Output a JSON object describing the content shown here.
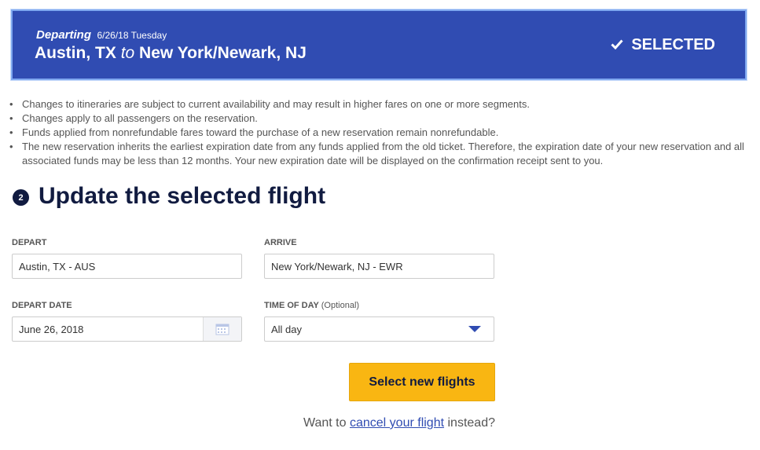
{
  "colors": {
    "banner": "#304cb2",
    "accent_button": "#f9b612",
    "title": "#111b40",
    "link": "#304cb2"
  },
  "banner": {
    "departing_label": "Departing",
    "date": "6/26/18 Tuesday",
    "origin": "Austin, TX",
    "to_word": "to",
    "destination": "New York/Newark, NJ",
    "status_icon": "check-icon",
    "status": "SELECTED"
  },
  "notes": [
    "Changes to itineraries are subject to current availability and may result in higher fares on one or more segments.",
    "Changes apply to all passengers on the reservation.",
    "Funds applied from nonrefundable fares toward the purchase of a new reservation remain nonrefundable.",
    "The new reservation inherits the earliest expiration date from any funds applied from the old ticket. Therefore, the expiration date of your new reservation and all associated funds may be less than 12 months. Your new expiration date will be displayed on the confirmation receipt sent to you."
  ],
  "section": {
    "step": "2",
    "title": "Update the selected flight"
  },
  "form": {
    "depart": {
      "label": "DEPART",
      "value": "Austin, TX - AUS"
    },
    "arrive": {
      "label": "ARRIVE",
      "value": "New York/Newark, NJ - EWR"
    },
    "depart_date": {
      "label": "DEPART DATE",
      "value": "June 26, 2018",
      "icon": "calendar-icon"
    },
    "time_of_day": {
      "label": "TIME OF DAY",
      "optional": "(Optional)",
      "value": "All day",
      "icon": "chevron-down-icon"
    },
    "submit": "Select new flights"
  },
  "footer": {
    "prefix": "Want to",
    "link": "cancel your flight",
    "suffix": "instead?"
  }
}
